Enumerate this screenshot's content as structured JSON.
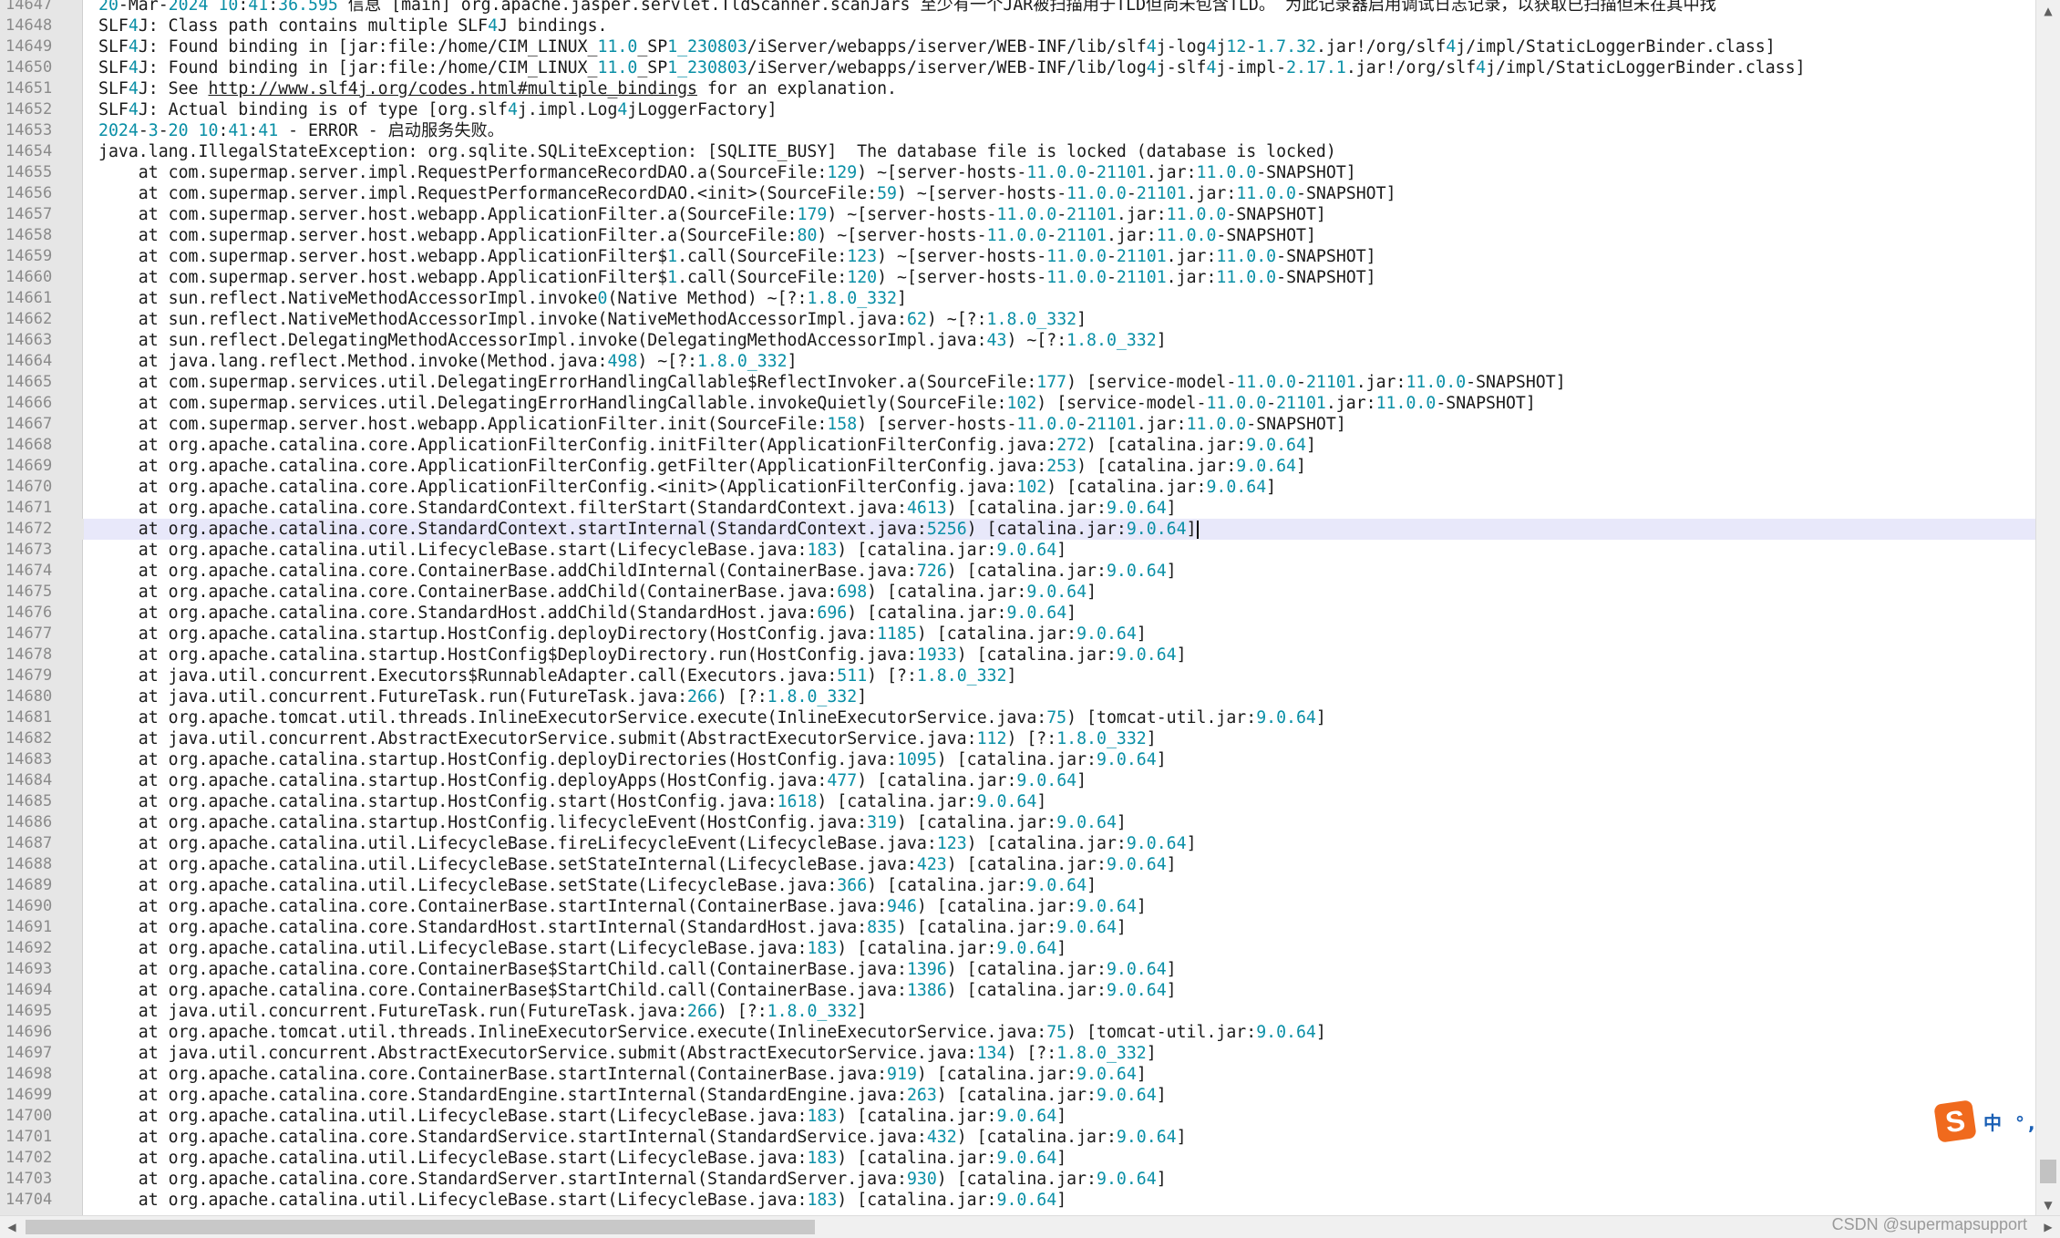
{
  "editor": {
    "current_line": "14672",
    "lines": [
      {
        "n": "14647",
        "t": "20-Mar-2024 10:41:36.595 信息 [main] org.apache.jasper.servlet.TldScanner.scanJars 至少有一个JAR被扫描用于TLD但尚未包含TLD。 为此记录器启用调试日志记录，以获取已扫描但未在其中找"
      },
      {
        "n": "14648",
        "t": "SLF4J: Class path contains multiple SLF4J bindings."
      },
      {
        "n": "14649",
        "t": "SLF4J: Found binding in [jar:file:/home/CIM_LINUX_11.0_SP1_230803/iServer/webapps/iserver/WEB-INF/lib/slf4j-log4j12-1.7.32.jar!/org/slf4j/impl/StaticLoggerBinder.class]"
      },
      {
        "n": "14650",
        "t": "SLF4J: Found binding in [jar:file:/home/CIM_LINUX_11.0_SP1_230803/iServer/webapps/iserver/WEB-INF/lib/log4j-slf4j-impl-2.17.1.jar!/org/slf4j/impl/StaticLoggerBinder.class]"
      },
      {
        "n": "14651",
        "t": "SLF4J: See http://www.slf4j.org/codes.html#multiple_bindings for an explanation."
      },
      {
        "n": "14652",
        "t": "SLF4J: Actual binding is of type [org.slf4j.impl.Log4jLoggerFactory]"
      },
      {
        "n": "14653",
        "t": "2024-3-20 10:41:41 - ERROR - 启动服务失败。"
      },
      {
        "n": "14654",
        "t": "java.lang.IllegalStateException: org.sqlite.SQLiteException: [SQLITE_BUSY]  The database file is locked (database is locked)"
      },
      {
        "n": "14655",
        "t": "    at com.supermap.server.impl.RequestPerformanceRecordDAO.a(SourceFile:129) ~[server-hosts-11.0.0-21101.jar:11.0.0-SNAPSHOT]"
      },
      {
        "n": "14656",
        "t": "    at com.supermap.server.impl.RequestPerformanceRecordDAO.<init>(SourceFile:59) ~[server-hosts-11.0.0-21101.jar:11.0.0-SNAPSHOT]"
      },
      {
        "n": "14657",
        "t": "    at com.supermap.server.host.webapp.ApplicationFilter.a(SourceFile:179) ~[server-hosts-11.0.0-21101.jar:11.0.0-SNAPSHOT]"
      },
      {
        "n": "14658",
        "t": "    at com.supermap.server.host.webapp.ApplicationFilter.a(SourceFile:80) ~[server-hosts-11.0.0-21101.jar:11.0.0-SNAPSHOT]"
      },
      {
        "n": "14659",
        "t": "    at com.supermap.server.host.webapp.ApplicationFilter$1.call(SourceFile:123) ~[server-hosts-11.0.0-21101.jar:11.0.0-SNAPSHOT]"
      },
      {
        "n": "14660",
        "t": "    at com.supermap.server.host.webapp.ApplicationFilter$1.call(SourceFile:120) ~[server-hosts-11.0.0-21101.jar:11.0.0-SNAPSHOT]"
      },
      {
        "n": "14661",
        "t": "    at sun.reflect.NativeMethodAccessorImpl.invoke0(Native Method) ~[?:1.8.0_332]"
      },
      {
        "n": "14662",
        "t": "    at sun.reflect.NativeMethodAccessorImpl.invoke(NativeMethodAccessorImpl.java:62) ~[?:1.8.0_332]"
      },
      {
        "n": "14663",
        "t": "    at sun.reflect.DelegatingMethodAccessorImpl.invoke(DelegatingMethodAccessorImpl.java:43) ~[?:1.8.0_332]"
      },
      {
        "n": "14664",
        "t": "    at java.lang.reflect.Method.invoke(Method.java:498) ~[?:1.8.0_332]"
      },
      {
        "n": "14665",
        "t": "    at com.supermap.services.util.DelegatingErrorHandlingCallable$ReflectInvoker.a(SourceFile:177) [service-model-11.0.0-21101.jar:11.0.0-SNAPSHOT]"
      },
      {
        "n": "14666",
        "t": "    at com.supermap.services.util.DelegatingErrorHandlingCallable.invokeQuietly(SourceFile:102) [service-model-11.0.0-21101.jar:11.0.0-SNAPSHOT]"
      },
      {
        "n": "14667",
        "t": "    at com.supermap.server.host.webapp.ApplicationFilter.init(SourceFile:158) [server-hosts-11.0.0-21101.jar:11.0.0-SNAPSHOT]"
      },
      {
        "n": "14668",
        "t": "    at org.apache.catalina.core.ApplicationFilterConfig.initFilter(ApplicationFilterConfig.java:272) [catalina.jar:9.0.64]"
      },
      {
        "n": "14669",
        "t": "    at org.apache.catalina.core.ApplicationFilterConfig.getFilter(ApplicationFilterConfig.java:253) [catalina.jar:9.0.64]"
      },
      {
        "n": "14670",
        "t": "    at org.apache.catalina.core.ApplicationFilterConfig.<init>(ApplicationFilterConfig.java:102) [catalina.jar:9.0.64]"
      },
      {
        "n": "14671",
        "t": "    at org.apache.catalina.core.StandardContext.filterStart(StandardContext.java:4613) [catalina.jar:9.0.64]"
      },
      {
        "n": "14672",
        "t": "    at org.apache.catalina.core.StandardContext.startInternal(StandardContext.java:5256) [catalina.jar:9.0.64]"
      },
      {
        "n": "14673",
        "t": "    at org.apache.catalina.util.LifecycleBase.start(LifecycleBase.java:183) [catalina.jar:9.0.64]"
      },
      {
        "n": "14674",
        "t": "    at org.apache.catalina.core.ContainerBase.addChildInternal(ContainerBase.java:726) [catalina.jar:9.0.64]"
      },
      {
        "n": "14675",
        "t": "    at org.apache.catalina.core.ContainerBase.addChild(ContainerBase.java:698) [catalina.jar:9.0.64]"
      },
      {
        "n": "14676",
        "t": "    at org.apache.catalina.core.StandardHost.addChild(StandardHost.java:696) [catalina.jar:9.0.64]"
      },
      {
        "n": "14677",
        "t": "    at org.apache.catalina.startup.HostConfig.deployDirectory(HostConfig.java:1185) [catalina.jar:9.0.64]"
      },
      {
        "n": "14678",
        "t": "    at org.apache.catalina.startup.HostConfig$DeployDirectory.run(HostConfig.java:1933) [catalina.jar:9.0.64]"
      },
      {
        "n": "14679",
        "t": "    at java.util.concurrent.Executors$RunnableAdapter.call(Executors.java:511) [?:1.8.0_332]"
      },
      {
        "n": "14680",
        "t": "    at java.util.concurrent.FutureTask.run(FutureTask.java:266) [?:1.8.0_332]"
      },
      {
        "n": "14681",
        "t": "    at org.apache.tomcat.util.threads.InlineExecutorService.execute(InlineExecutorService.java:75) [tomcat-util.jar:9.0.64]"
      },
      {
        "n": "14682",
        "t": "    at java.util.concurrent.AbstractExecutorService.submit(AbstractExecutorService.java:112) [?:1.8.0_332]"
      },
      {
        "n": "14683",
        "t": "    at org.apache.catalina.startup.HostConfig.deployDirectories(HostConfig.java:1095) [catalina.jar:9.0.64]"
      },
      {
        "n": "14684",
        "t": "    at org.apache.catalina.startup.HostConfig.deployApps(HostConfig.java:477) [catalina.jar:9.0.64]"
      },
      {
        "n": "14685",
        "t": "    at org.apache.catalina.startup.HostConfig.start(HostConfig.java:1618) [catalina.jar:9.0.64]"
      },
      {
        "n": "14686",
        "t": "    at org.apache.catalina.startup.HostConfig.lifecycleEvent(HostConfig.java:319) [catalina.jar:9.0.64]"
      },
      {
        "n": "14687",
        "t": "    at org.apache.catalina.util.LifecycleBase.fireLifecycleEvent(LifecycleBase.java:123) [catalina.jar:9.0.64]"
      },
      {
        "n": "14688",
        "t": "    at org.apache.catalina.util.LifecycleBase.setStateInternal(LifecycleBase.java:423) [catalina.jar:9.0.64]"
      },
      {
        "n": "14689",
        "t": "    at org.apache.catalina.util.LifecycleBase.setState(LifecycleBase.java:366) [catalina.jar:9.0.64]"
      },
      {
        "n": "14690",
        "t": "    at org.apache.catalina.core.ContainerBase.startInternal(ContainerBase.java:946) [catalina.jar:9.0.64]"
      },
      {
        "n": "14691",
        "t": "    at org.apache.catalina.core.StandardHost.startInternal(StandardHost.java:835) [catalina.jar:9.0.64]"
      },
      {
        "n": "14692",
        "t": "    at org.apache.catalina.util.LifecycleBase.start(LifecycleBase.java:183) [catalina.jar:9.0.64]"
      },
      {
        "n": "14693",
        "t": "    at org.apache.catalina.core.ContainerBase$StartChild.call(ContainerBase.java:1396) [catalina.jar:9.0.64]"
      },
      {
        "n": "14694",
        "t": "    at org.apache.catalina.core.ContainerBase$StartChild.call(ContainerBase.java:1386) [catalina.jar:9.0.64]"
      },
      {
        "n": "14695",
        "t": "    at java.util.concurrent.FutureTask.run(FutureTask.java:266) [?:1.8.0_332]"
      },
      {
        "n": "14696",
        "t": "    at org.apache.tomcat.util.threads.InlineExecutorService.execute(InlineExecutorService.java:75) [tomcat-util.jar:9.0.64]"
      },
      {
        "n": "14697",
        "t": "    at java.util.concurrent.AbstractExecutorService.submit(AbstractExecutorService.java:134) [?:1.8.0_332]"
      },
      {
        "n": "14698",
        "t": "    at org.apache.catalina.core.ContainerBase.startInternal(ContainerBase.java:919) [catalina.jar:9.0.64]"
      },
      {
        "n": "14699",
        "t": "    at org.apache.catalina.core.StandardEngine.startInternal(StandardEngine.java:263) [catalina.jar:9.0.64]"
      },
      {
        "n": "14700",
        "t": "    at org.apache.catalina.util.LifecycleBase.start(LifecycleBase.java:183) [catalina.jar:9.0.64]"
      },
      {
        "n": "14701",
        "t": "    at org.apache.catalina.core.StandardService.startInternal(StandardService.java:432) [catalina.jar:9.0.64]"
      },
      {
        "n": "14702",
        "t": "    at org.apache.catalina.util.LifecycleBase.start(LifecycleBase.java:183) [catalina.jar:9.0.64]"
      },
      {
        "n": "14703",
        "t": "    at org.apache.catalina.core.StandardServer.startInternal(StandardServer.java:930) [catalina.jar:9.0.64]"
      },
      {
        "n": "14704",
        "t": "    at org.apache.catalina.util.LifecycleBase.start(LifecycleBase.java:183) [catalina.jar:9.0.64]"
      }
    ]
  },
  "scrollbars": {
    "up_arrow": "▲",
    "down_arrow": "▼",
    "left_arrow": "◀",
    "right_arrow": "▶"
  },
  "ime": {
    "logo": "S",
    "status": "中 °,"
  },
  "watermark": "CSDN @supermapsupport",
  "colors": {
    "number": "#0a8fa6",
    "text": "#1a1a1a",
    "current_line_bg": "#e8e8fa",
    "gutter_bg": "#e6e6e6"
  }
}
